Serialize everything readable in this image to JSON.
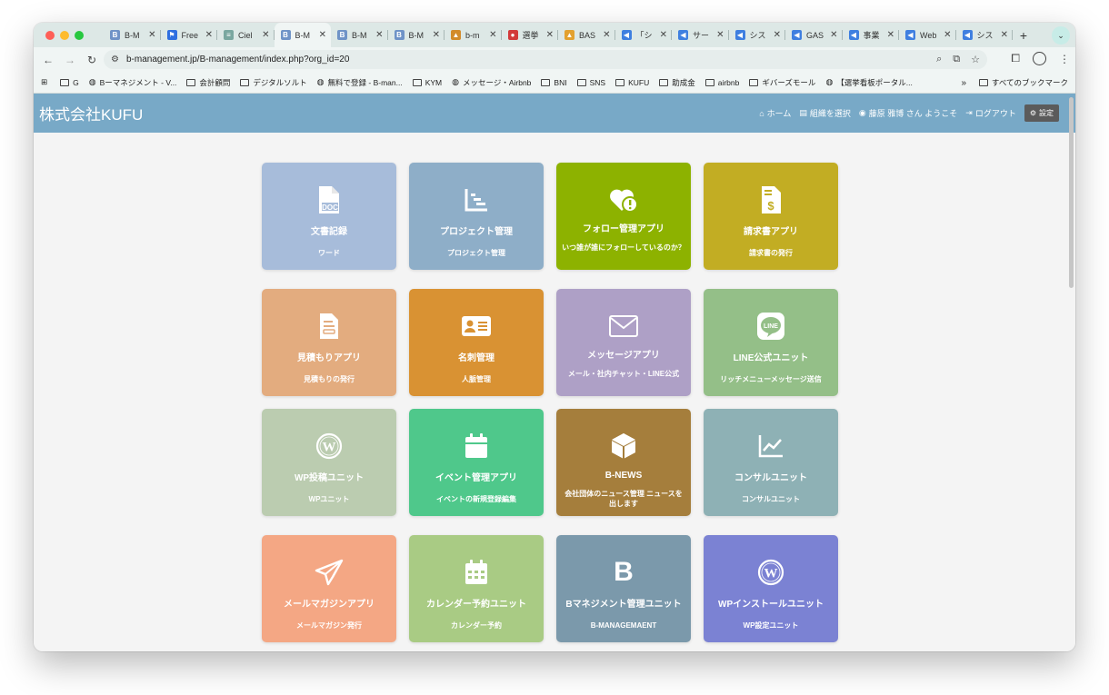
{
  "browser": {
    "tabs": [
      {
        "title": "B-M",
        "favicon_color": "#6f93c7",
        "favicon_char": "B"
      },
      {
        "title": "Free",
        "favicon_color": "#2f6fe0",
        "favicon_char": "⚑"
      },
      {
        "title": "Ciel",
        "favicon_color": "#7aa7a0",
        "favicon_char": "≡"
      },
      {
        "title": "B-M",
        "favicon_color": "#6f93c7",
        "favicon_char": "B",
        "active": true
      },
      {
        "title": "B-M",
        "favicon_color": "#6f93c7",
        "favicon_char": "B"
      },
      {
        "title": "B-M",
        "favicon_color": "#6f93c7",
        "favicon_char": "B"
      },
      {
        "title": "b-m",
        "favicon_color": "#d28b2b",
        "favicon_char": "▲"
      },
      {
        "title": "選挙",
        "favicon_color": "#d23a3a",
        "favicon_char": "●"
      },
      {
        "title": "BAS",
        "favicon_color": "#e3a12f",
        "favicon_char": "▲"
      },
      {
        "title": "「シ",
        "favicon_color": "#3f7fe0",
        "favicon_char": "◀"
      },
      {
        "title": "サー",
        "favicon_color": "#3f7fe0",
        "favicon_char": "◀"
      },
      {
        "title": "シス",
        "favicon_color": "#3f7fe0",
        "favicon_char": "◀"
      },
      {
        "title": "GAS",
        "favicon_color": "#3f7fe0",
        "favicon_char": "◀"
      },
      {
        "title": "事業",
        "favicon_color": "#3f7fe0",
        "favicon_char": "◀"
      },
      {
        "title": "Web",
        "favicon_color": "#3f7fe0",
        "favicon_char": "◀"
      },
      {
        "title": "シス",
        "favicon_color": "#3f7fe0",
        "favicon_char": "◀"
      }
    ],
    "new_tab": "+",
    "url": "b-management.jp/B-management/index.php?org_id=20",
    "bookmarks": [
      {
        "label": "G",
        "kind": "folder"
      },
      {
        "label": "Bーマネジメント - V...",
        "kind": "site"
      },
      {
        "label": "会計顧問",
        "kind": "folder"
      },
      {
        "label": "デジタルソルト",
        "kind": "folder"
      },
      {
        "label": "無料で登録 - B-man...",
        "kind": "site"
      },
      {
        "label": "KYM",
        "kind": "folder"
      },
      {
        "label": "メッセージ・Airbnb",
        "kind": "site"
      },
      {
        "label": "BNI",
        "kind": "folder"
      },
      {
        "label": "SNS",
        "kind": "folder"
      },
      {
        "label": "KUFU",
        "kind": "folder"
      },
      {
        "label": "助成金",
        "kind": "folder"
      },
      {
        "label": "airbnb",
        "kind": "folder"
      },
      {
        "label": "ギバーズモール",
        "kind": "folder"
      },
      {
        "label": "【選挙看板ポータル...",
        "kind": "site"
      }
    ],
    "bookmarks_more": "»",
    "all_bookmarks": "すべてのブックマーク"
  },
  "header": {
    "brand": "株式会社KUFU",
    "nav": {
      "home": "ホーム",
      "select_org": "組織を選択",
      "user_greeting": "藤原 雅博 さん ようこそ",
      "logout": "ログアウト",
      "settings": "設定"
    }
  },
  "apps": [
    {
      "title": "文書記録",
      "subtitle": "ワード",
      "color": "#a7bcda",
      "icon": "doc-icon"
    },
    {
      "title": "プロジェクト管理",
      "subtitle": "プロジェクト管理",
      "color": "#8eaec8",
      "icon": "gantt-icon"
    },
    {
      "title": "フォロー管理アプリ",
      "subtitle": "いつ誰が誰にフォローしているのか？",
      "color": "#8db200",
      "icon": "heart-alert-icon"
    },
    {
      "title": "請求書アプリ",
      "subtitle": "請求書の発行",
      "color": "#c2ad23",
      "icon": "invoice-icon"
    },
    {
      "title": "見積もりアプリ",
      "subtitle": "見積もりの発行",
      "color": "#e3ac7f",
      "icon": "estimate-icon"
    },
    {
      "title": "名刺管理",
      "subtitle": "人脈管理",
      "color": "#d99233",
      "icon": "business-card-icon"
    },
    {
      "title": "メッセージアプリ",
      "subtitle": "メール・社内チャット・LINE公式",
      "color": "#aea0c6",
      "icon": "envelope-icon"
    },
    {
      "title": "LINE公式ユニット",
      "subtitle": "リッチメニューメッセージ送信",
      "color": "#94bf88",
      "icon": "line-icon"
    },
    {
      "title": "WP投稿ユニット",
      "subtitle": "WPユニット",
      "color": "#bbccb0",
      "icon": "wordpress-icon"
    },
    {
      "title": "イベント管理アプリ",
      "subtitle": "イベントの新規登録編集",
      "color": "#4fc88b",
      "icon": "calendar-icon"
    },
    {
      "title": "B-NEWS",
      "subtitle": "会社団体のニュース管理 ニュースを出します",
      "color": "#a57e3c",
      "icon": "cube-icon"
    },
    {
      "title": "コンサルユニット",
      "subtitle": "コンサルユニット",
      "color": "#8eb1b5",
      "icon": "line-chart-icon"
    },
    {
      "title": "メールマガジンアプリ",
      "subtitle": "メールマガジン発行",
      "color": "#f4a784",
      "icon": "paper-plane-icon"
    },
    {
      "title": "カレンダー予約ユニット",
      "subtitle": "カレンダー予約",
      "color": "#a9cb84",
      "icon": "calendar-grid-icon"
    },
    {
      "title": "Bマネジメント管理ユニット",
      "subtitle": "B-MANAGEMAENT",
      "color": "#7b99ab",
      "icon": "b-letter-icon",
      "glyph": "B"
    },
    {
      "title": "WPインストールユニット",
      "subtitle": "WP設定ユニット",
      "color": "#7b82d3",
      "icon": "wordpress-icon"
    }
  ]
}
